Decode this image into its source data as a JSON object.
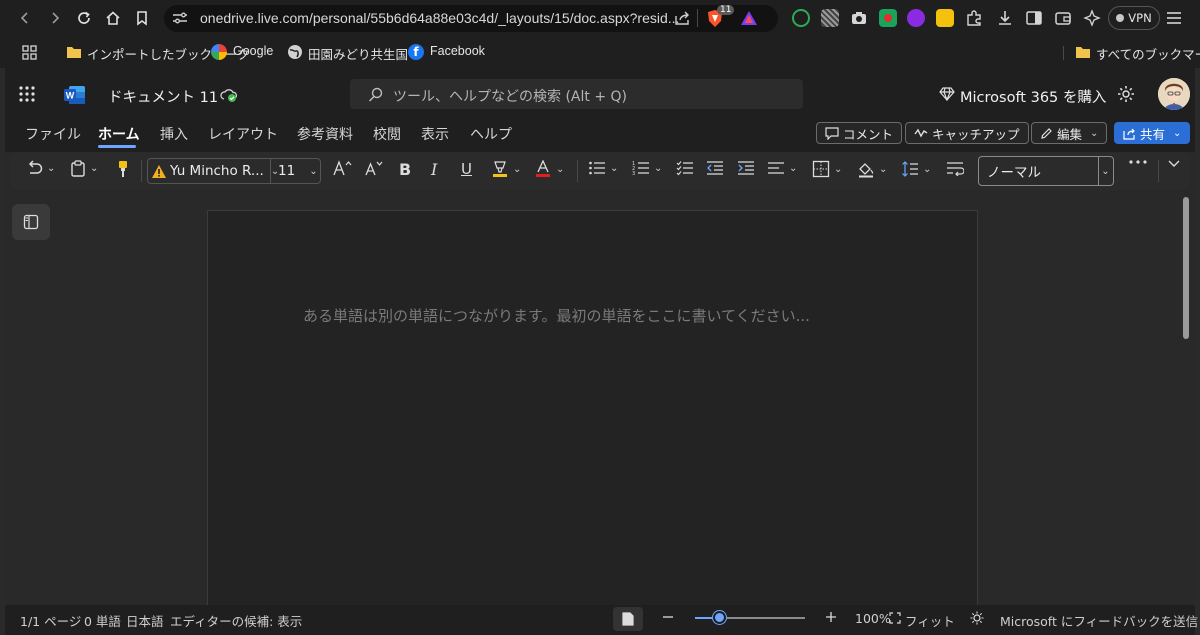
{
  "browser": {
    "url": "onedrive.live.com/personal/55b6d64a88e03c4d/_layouts/15/doc.aspx?resid...",
    "shield_badge": "11",
    "vpn_label": "VPN"
  },
  "bookmarks": {
    "items": [
      "インポートしたブックマーク",
      "Google",
      "田園みどり共生国",
      "Facebook"
    ],
    "all_bookmarks": "すべてのブックマーク"
  },
  "app": {
    "doc_title": "ドキュメント 11",
    "search_placeholder": "ツール、ヘルプなどの検索 (Alt + Q)",
    "buy_label": "Microsoft 365 を購入"
  },
  "ribbon": {
    "tabs": [
      "ファイル",
      "ホーム",
      "挿入",
      "レイアウト",
      "参考資料",
      "校閲",
      "表示",
      "ヘルプ"
    ],
    "active_tab": "ホーム",
    "comment_label": "コメント",
    "catchup_label": "キャッチアップ",
    "edit_label": "編集",
    "share_label": "共有"
  },
  "toolbar": {
    "font_name": "Yu Mincho R...",
    "font_size": "11",
    "style_value": "ノーマル",
    "bold": "B",
    "italic": "I",
    "underline": "U"
  },
  "document": {
    "placeholder": "ある単語は別の単語につながります。最初の単語をここに書いてください..."
  },
  "status": {
    "page": "1/1 ページ",
    "words": "0 単語",
    "language": "日本語",
    "editor": "エディターの候補: 表示",
    "zoom": "100%",
    "fit": "フィット",
    "feedback": "Microsoft にフィードバックを送信"
  },
  "colors": {
    "accent": "#2b6fd6",
    "word_blue": "#185abd",
    "font_red": "#e02020",
    "highlight_yellow": "#f2c21b"
  }
}
